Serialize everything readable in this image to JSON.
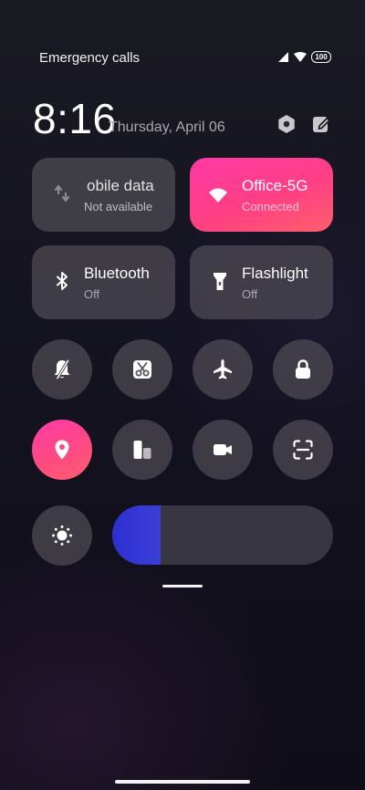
{
  "status_bar": {
    "carrier_text": "Emergency calls",
    "battery_level": "100",
    "signal_icon": "signal-icon",
    "wifi_icon": "wifi-icon"
  },
  "header": {
    "time": "8:16",
    "date": "Thursday, April 06",
    "settings_icon": "settings-icon",
    "edit_icon": "edit-icon"
  },
  "tiles": {
    "mobile_data": {
      "title": "obile data",
      "subtitle": "Not available",
      "icon": "mobile-data-icon"
    },
    "wifi": {
      "title": "Office-5G",
      "subtitle": "Connected",
      "icon": "wifi-icon"
    },
    "bluetooth": {
      "title": "Bluetooth",
      "subtitle": "Off",
      "icon": "bluetooth-icon"
    },
    "flashlight": {
      "title": "Flashlight",
      "subtitle": "Off",
      "icon": "flashlight-icon"
    }
  },
  "toggles": [
    {
      "icon": "bell-mute-icon",
      "active": false
    },
    {
      "icon": "screenshot-scissors-icon",
      "active": false
    },
    {
      "icon": "airplane-icon",
      "active": false
    },
    {
      "icon": "lock-icon",
      "active": false
    },
    {
      "icon": "location-icon",
      "active": true
    },
    {
      "icon": "floating-window-icon",
      "active": false
    },
    {
      "icon": "screen-record-icon",
      "active": false
    },
    {
      "icon": "scanner-icon",
      "active": false
    }
  ],
  "brightness": {
    "icon": "brightness-icon",
    "level": 0.22
  },
  "colors": {
    "accent_pink": "#ff3f8f",
    "tile_dark": "#58565e",
    "brightness_fill": "#3336d4"
  }
}
